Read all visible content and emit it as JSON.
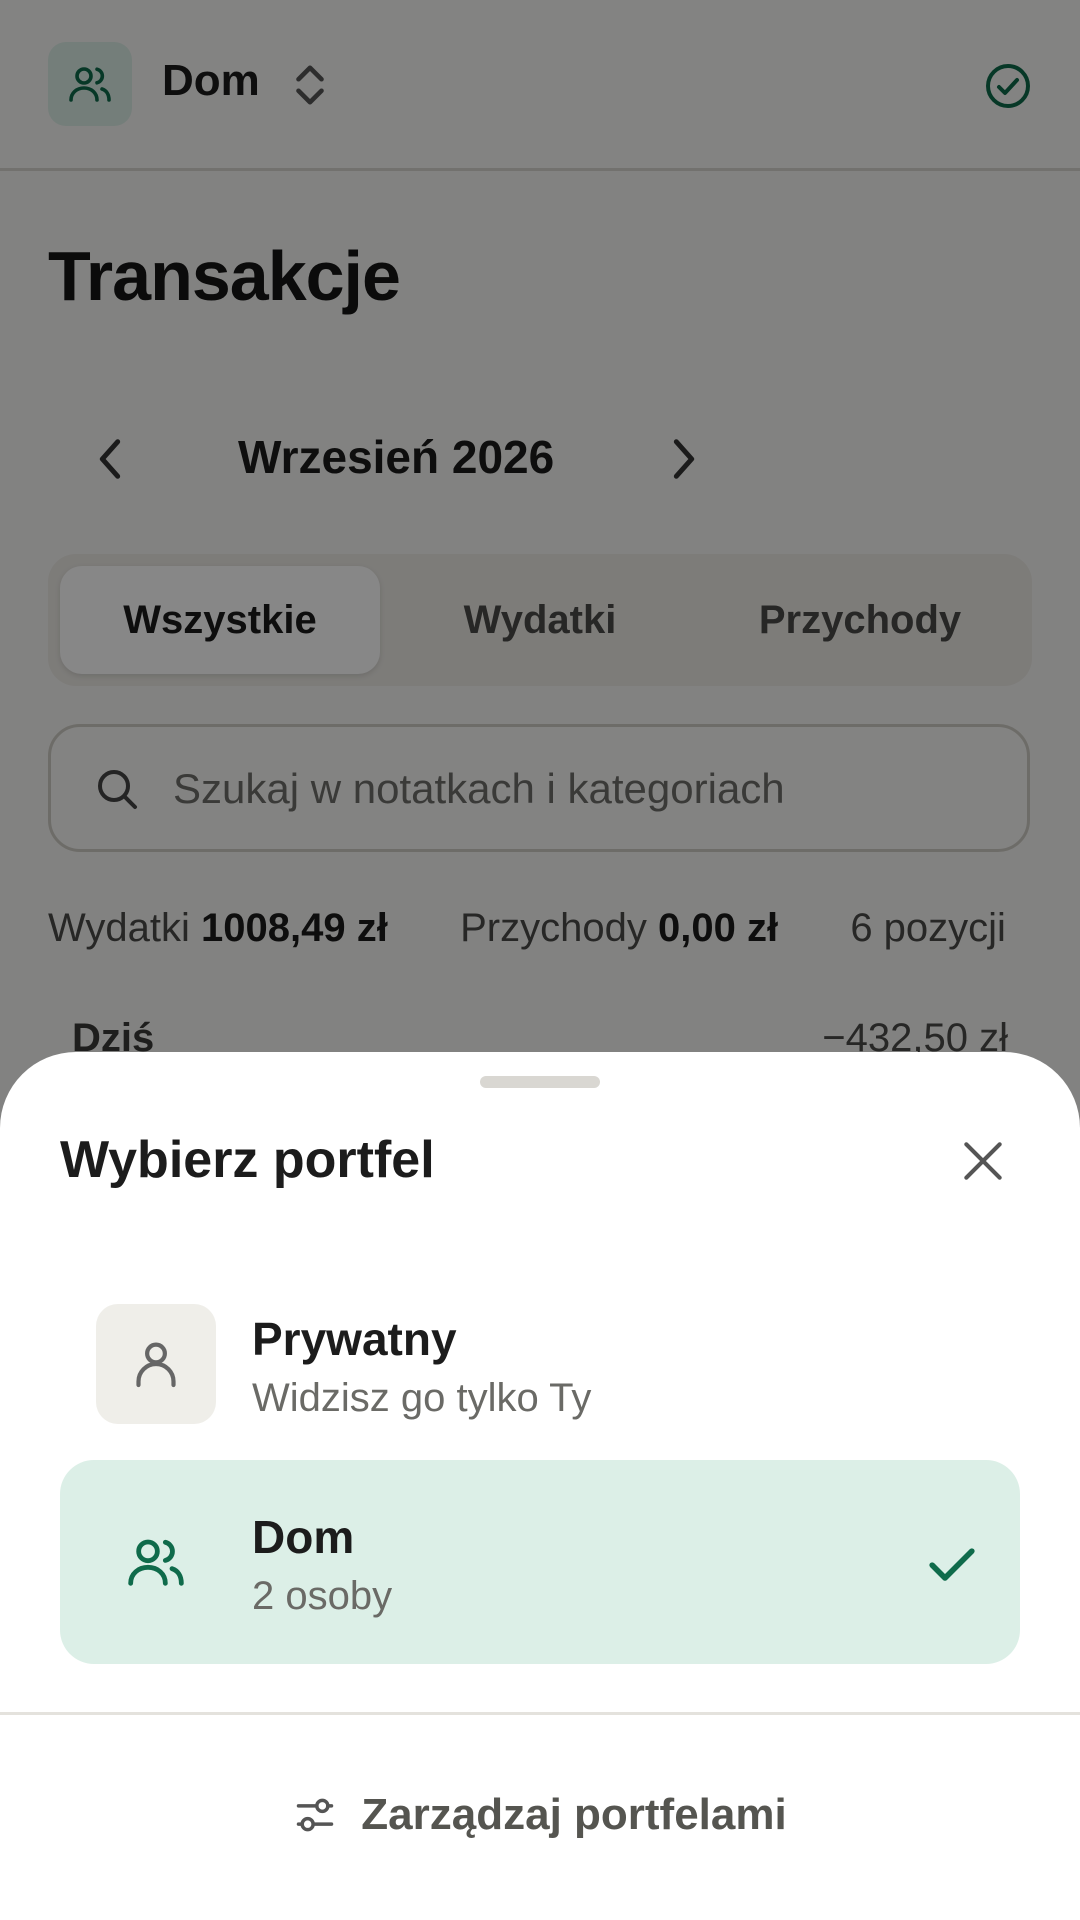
{
  "colors": {
    "accent": "#0f6b4b",
    "accent_bg": "#dcefe7",
    "scrim": "rgba(0,0,0,0.47)"
  },
  "header": {
    "wallet_name": "Dom",
    "wallet_icon": "users-icon",
    "switch_icon": "chevron-up-down-icon",
    "status_icon": "check-circle-icon"
  },
  "page": {
    "title": "Transakcje"
  },
  "month_nav": {
    "label": "Wrzesień 2026",
    "prev_icon": "chevron-left-icon",
    "next_icon": "chevron-right-icon"
  },
  "filters": {
    "tabs": [
      {
        "label": "Wszystkie",
        "active": true
      },
      {
        "label": "Wydatki",
        "active": false
      },
      {
        "label": "Przychody",
        "active": false
      }
    ]
  },
  "search": {
    "placeholder": "Szukaj w notatkach i kategoriach",
    "icon": "search-icon"
  },
  "summary": {
    "expenses_label": "Wydatki",
    "expenses_value": "1008,49 zł",
    "income_label": "Przychody",
    "income_value": "0,00 zł",
    "count": "6 pozycji"
  },
  "day_group": {
    "label": "Dziś",
    "total": "−432,50 zł"
  },
  "sheet": {
    "title": "Wybierz portfel",
    "close_icon": "close-icon",
    "wallets": [
      {
        "name": "Prywatny",
        "subtitle": "Widzisz go tylko Ty",
        "icon": "user-icon",
        "selected": false
      },
      {
        "name": "Dom",
        "subtitle": "2 osoby",
        "icon": "users-icon",
        "selected": true
      }
    ],
    "manage_label": "Zarządzaj portfelami",
    "manage_icon": "sliders-icon"
  }
}
